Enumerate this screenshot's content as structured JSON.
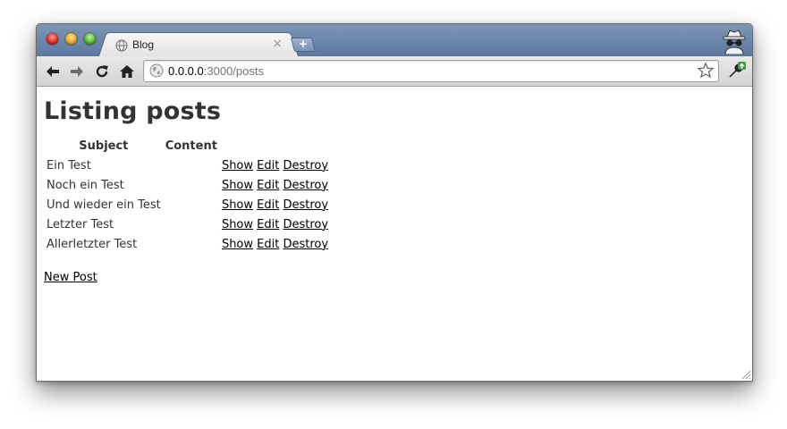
{
  "browser": {
    "tab_title": "Blog",
    "tab_close": "×",
    "new_tab": "+",
    "url_host": "0.0.0.0",
    "url_rest": ":3000/posts"
  },
  "page": {
    "title": "Listing posts",
    "columns": [
      "Subject",
      "Content"
    ],
    "rows": [
      {
        "subject": "Ein Test",
        "content": "",
        "show": "Show",
        "edit": "Edit",
        "destroy": "Destroy"
      },
      {
        "subject": "Noch ein Test",
        "content": "",
        "show": "Show",
        "edit": "Edit",
        "destroy": "Destroy"
      },
      {
        "subject": "Und wieder ein Test",
        "content": "",
        "show": "Show",
        "edit": "Edit",
        "destroy": "Destroy"
      },
      {
        "subject": "Letzter Test",
        "content": "",
        "show": "Show",
        "edit": "Edit",
        "destroy": "Destroy"
      },
      {
        "subject": "Allerletzter Test",
        "content": "",
        "show": "Show",
        "edit": "Edit",
        "destroy": "Destroy"
      }
    ],
    "new_link": "New Post"
  },
  "icons": {
    "traffic_lights": [
      "close-light-icon",
      "minimize-light-icon",
      "zoom-light-icon"
    ],
    "tab_favicon": "globe-favicon-icon",
    "incognito": "incognito-icon",
    "toolbar": [
      "back-arrow-icon",
      "forward-arrow-icon",
      "reload-icon",
      "home-icon"
    ],
    "omnibox": [
      "globe-icon",
      "bookmark-star-icon"
    ],
    "menu": "wrench-update-icon"
  }
}
